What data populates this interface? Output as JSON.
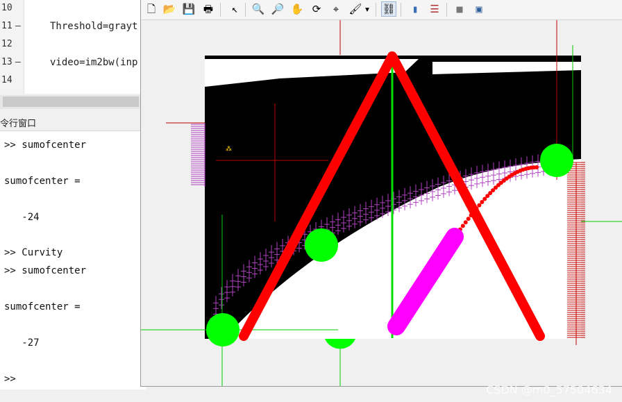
{
  "editor": {
    "lines": [
      {
        "num": "10",
        "dash": "",
        "code": ""
      },
      {
        "num": "11",
        "dash": "—",
        "code": "Threshold=grayt"
      },
      {
        "num": "12",
        "dash": "",
        "code": ""
      },
      {
        "num": "13",
        "dash": "—",
        "code": "video=im2bw(inp"
      },
      {
        "num": "14",
        "dash": "",
        "code": ""
      }
    ]
  },
  "command_window": {
    "title": "令行窗口",
    "lines": [
      ">> sumofcenter",
      "",
      "sumofcenter =",
      "",
      "   -24",
      "",
      ">> Curvity",
      ">> sumofcenter",
      "",
      "sumofcenter =",
      "",
      "   -27",
      "",
      ">>"
    ]
  },
  "figure": {
    "toolbar": {
      "icons": [
        {
          "name": "new-figure-icon",
          "glyph": "🗋"
        },
        {
          "name": "open-file-icon",
          "glyph": "📂"
        },
        {
          "name": "save-icon",
          "glyph": "💾"
        },
        {
          "name": "print-icon",
          "glyph": "🖶"
        },
        {
          "name": "edit-plot-arrow-icon",
          "glyph": "↖"
        },
        {
          "name": "zoom-in-icon",
          "glyph": "🔍"
        },
        {
          "name": "zoom-out-icon",
          "glyph": "🔎"
        },
        {
          "name": "pan-hand-icon",
          "glyph": "✋"
        },
        {
          "name": "rotate-3d-icon",
          "glyph": "⟳"
        },
        {
          "name": "data-cursor-icon",
          "glyph": "⌖"
        },
        {
          "name": "brush-icon",
          "glyph": "🖌"
        },
        {
          "name": "brush-dropdown-icon",
          "glyph": "▾"
        },
        {
          "name": "link-plot-icon",
          "glyph": "⛓"
        },
        {
          "name": "colorbar-icon",
          "glyph": "▮"
        },
        {
          "name": "legend-icon",
          "glyph": "☰"
        },
        {
          "name": "hide-plot-tools-icon",
          "glyph": "■"
        },
        {
          "name": "show-plot-tools-icon",
          "glyph": "▣"
        }
      ]
    },
    "colors": {
      "background": "#f0f0f0",
      "red": "#ff0000",
      "green": "#00ff00",
      "magenta": "#ff00ff",
      "purple_marks": "#b040c0",
      "dark_red": "#c00000"
    }
  },
  "watermark": "CSDN @m0_57504634"
}
